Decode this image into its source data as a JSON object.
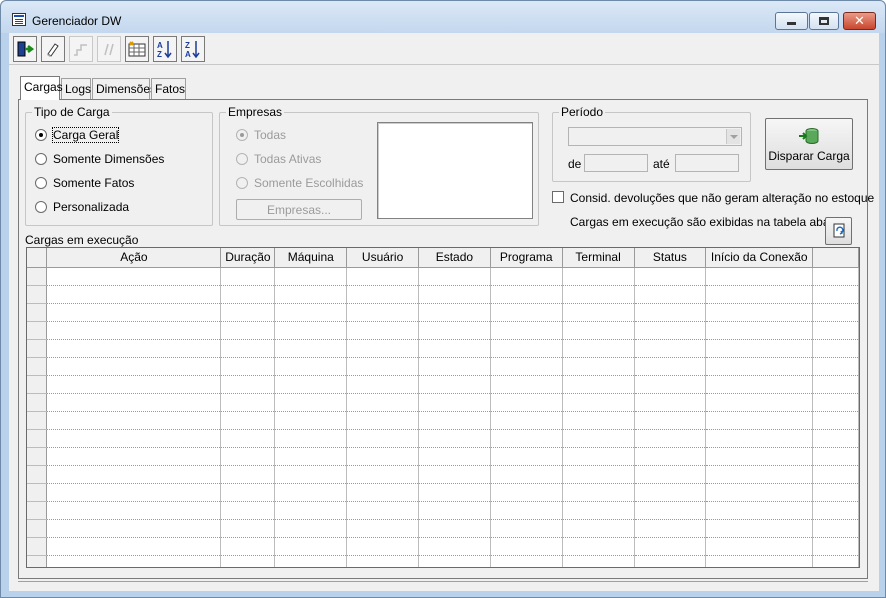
{
  "window": {
    "title": "Gerenciador DW"
  },
  "toolbar": {
    "buttons": [
      {
        "icon": "exit-door-icon",
        "enabled": true
      },
      {
        "icon": "eraser-icon",
        "enabled": true
      },
      {
        "icon": "step-icon",
        "enabled": false
      },
      {
        "icon": "loop-icon",
        "enabled": false
      },
      {
        "icon": "table-columns-icon",
        "enabled": true
      },
      {
        "icon": "sort-az-icon",
        "enabled": true
      },
      {
        "icon": "sort-za-icon",
        "enabled": true
      }
    ]
  },
  "tabs": [
    "Cargas",
    "Logs",
    "Dimensões",
    "Fatos"
  ],
  "tipo_carga": {
    "label": "Tipo de Carga",
    "options": [
      "Carga Geral",
      "Somente Dimensões",
      "Somente Fatos",
      "Personalizada"
    ],
    "selected": "Carga Geral"
  },
  "empresas": {
    "label": "Empresas",
    "options": [
      "Todas",
      "Todas Ativas",
      "Somente Escolhidas"
    ],
    "selected": "Todas",
    "button": "Empresas..."
  },
  "periodo": {
    "label": "Período",
    "de_label": "de",
    "ate_label": "até"
  },
  "disparar_button": "Disparar Carga",
  "consid_checkbox": "Consid. devoluções que não geram alteração no estoque",
  "info_text": "Cargas em execução são exibidas na tabela abaixo",
  "grid": {
    "label": "Cargas em execução",
    "columns": [
      "Ação",
      "Duração",
      "Máquina",
      "Usuário",
      "Estado",
      "Programa",
      "Terminal",
      "Status",
      "Início da Conexão"
    ],
    "row_count": 17
  }
}
